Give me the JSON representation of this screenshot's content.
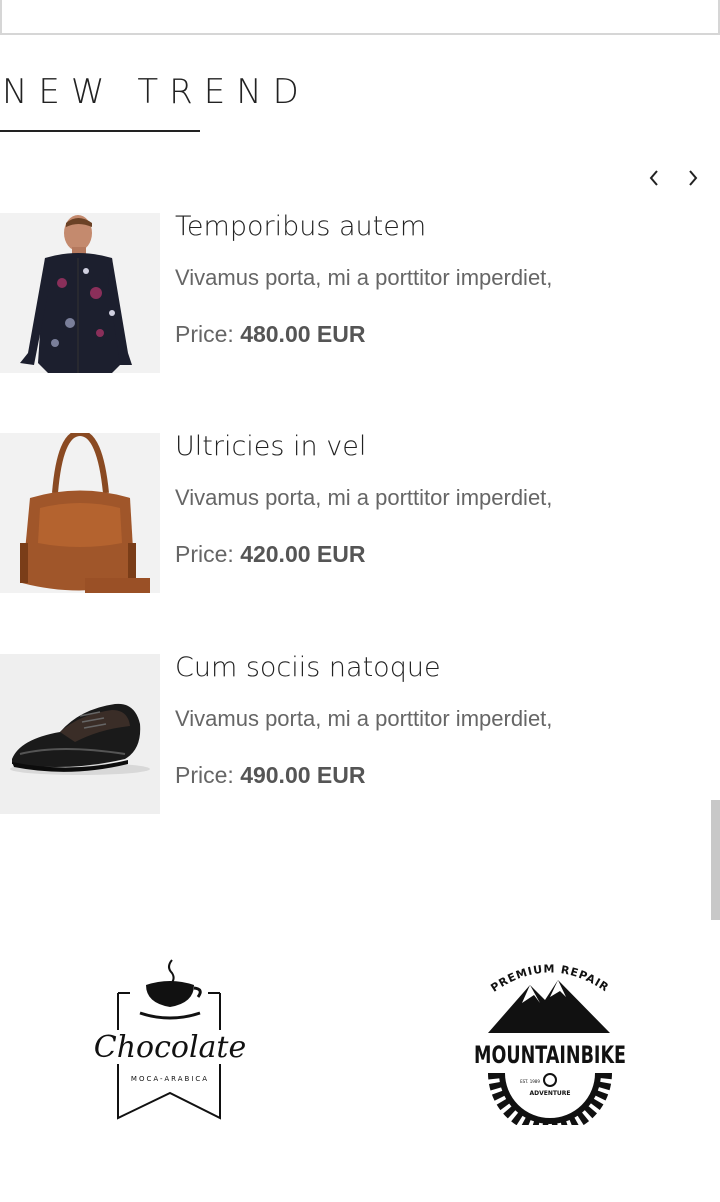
{
  "section": {
    "title": "NEW TREND"
  },
  "carousel": {
    "prev_icon": "chevron-left-icon",
    "next_icon": "chevron-right-icon"
  },
  "products": [
    {
      "name": "Temporibus autem",
      "description": "Vivamus porta, mi a porttitor imperdiet,",
      "price_label": "Price:",
      "price": "480.00 EUR",
      "image": "floral-shirt"
    },
    {
      "name": "Ultricies in vel",
      "description": "Vivamus porta, mi a porttitor imperdiet,",
      "price_label": "Price:",
      "price": "420.00 EUR",
      "image": "leather-handbag"
    },
    {
      "name": "Cum sociis natoque",
      "description": "Vivamus porta, mi a porttitor imperdiet,",
      "price_label": "Price:",
      "price": "490.00 EUR",
      "image": "leather-shoe"
    }
  ],
  "brands": [
    {
      "name": "Chocolate",
      "tagline": "MOCA-ARABICA"
    },
    {
      "name": "MOUNTAINBIKE",
      "arc_text": "PREMIUM REPAIR",
      "bottom_text": "ADVENTURE",
      "est": "EST. 1989"
    }
  ],
  "colors": {
    "text": "#222222",
    "muted": "#666666",
    "thumb_bg": "#efefef"
  }
}
